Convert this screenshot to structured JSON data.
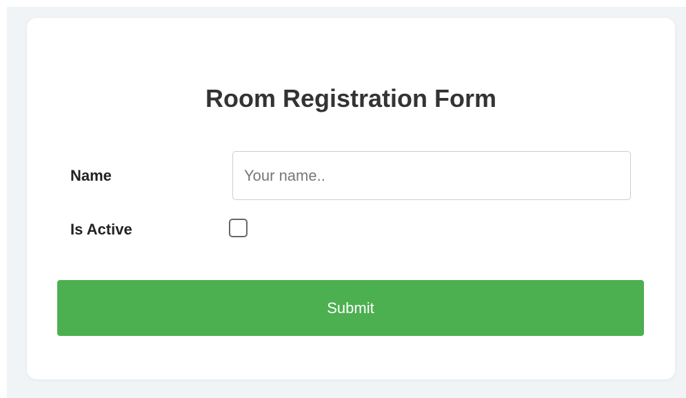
{
  "form": {
    "title": "Room Registration Form",
    "name_label": "Name",
    "name_value": "",
    "name_placeholder": "Your name..",
    "active_label": "Is Active",
    "active_checked": false,
    "submit_label": "Submit"
  },
  "colors": {
    "page_background": "#f1f4f6",
    "card_background": "#ffffff",
    "submit_background": "#4caf50",
    "submit_text": "#ffffff",
    "title_text": "#333333"
  }
}
